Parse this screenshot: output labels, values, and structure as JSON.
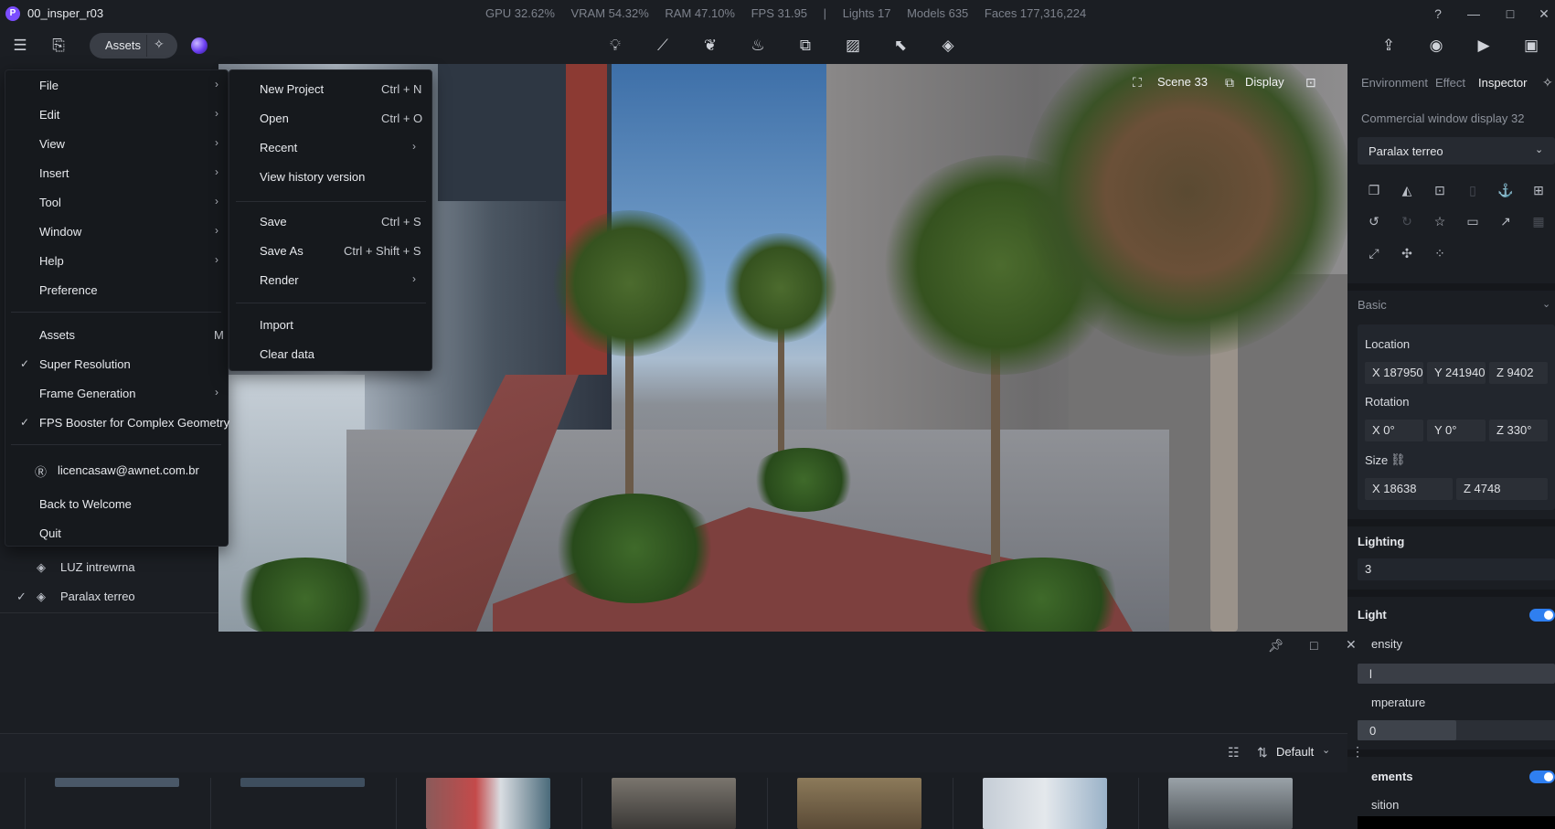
{
  "titlebar": {
    "app_title": "00_insper_r03",
    "logo_letter": "P",
    "stats": [
      "GPU 32.62%",
      "VRAM 54.32%",
      "RAM 47.10%",
      "FPS 31.95",
      "|",
      "Lights 17",
      "Models 635",
      "Faces 177,316,224"
    ]
  },
  "toolbar": {
    "assets_label": "Assets"
  },
  "viewport": {
    "scene_label": "Scene 33",
    "display_label": "Display"
  },
  "main_menu": {
    "items": [
      {
        "label": "File",
        "submenu": true
      },
      {
        "label": "Edit",
        "submenu": true
      },
      {
        "label": "View",
        "submenu": true
      },
      {
        "label": "Insert",
        "submenu": true
      },
      {
        "label": "Tool",
        "submenu": true
      },
      {
        "label": "Window",
        "submenu": true
      },
      {
        "label": "Help",
        "submenu": true
      },
      {
        "label": "Preference"
      },
      {
        "label": "Assets",
        "shortcut": "M"
      },
      {
        "label": "Super Resolution",
        "checked": true
      },
      {
        "label": "Frame Generation",
        "submenu": true
      },
      {
        "label": "FPS Booster for Complex Geometry",
        "checked": true
      },
      {
        "label": "licencasaw@awnet.com.br"
      },
      {
        "label": "Back to Welcome"
      },
      {
        "label": "Quit"
      }
    ]
  },
  "file_submenu": {
    "items": [
      {
        "label": "New Project",
        "shortcut": "Ctrl + N"
      },
      {
        "label": "Open",
        "shortcut": "Ctrl + O"
      },
      {
        "label": "Recent",
        "submenu": true
      },
      {
        "label": "View history version"
      },
      {
        "label": "Save",
        "shortcut": "Ctrl + S"
      },
      {
        "label": "Save As",
        "shortcut": "Ctrl + Shift + S"
      },
      {
        "label": "Render",
        "submenu": true
      },
      {
        "label": "Import"
      },
      {
        "label": "Clear data"
      }
    ]
  },
  "layers": [
    {
      "label": "LUZ intrewrna",
      "checked": false
    },
    {
      "label": "Paralax terreo",
      "checked": true
    }
  ],
  "inspector": {
    "tabs": [
      "Environment",
      "Effect",
      "Inspector"
    ],
    "object_name": "Commercial window display 32",
    "model_dropdown": "Paralax terreo",
    "basic_label": "Basic",
    "location_label": "Location",
    "location": {
      "x": "X 187950",
      "y": "Y 241940",
      "z": "Z 9402"
    },
    "rotation_label": "Rotation",
    "rotation": {
      "x": "X 0°",
      "y": "Y 0°",
      "z": "Z 330°"
    },
    "size_label": "Size",
    "size": {
      "x": "X 18638",
      "z": "Z 4748"
    },
    "lighting_label": "Lighting",
    "lighting_value": "3",
    "light_label": "Light",
    "intensity_label": "ensity",
    "intensity_value": "l",
    "temperature_label": "mperature",
    "temperature_value": "0",
    "elements_label": "ements",
    "position_label": "sition"
  },
  "bottom_panel": {
    "sort_label": "Default"
  },
  "colors": {
    "accent": "#2f7ff0",
    "brand": "#7b4dff"
  }
}
